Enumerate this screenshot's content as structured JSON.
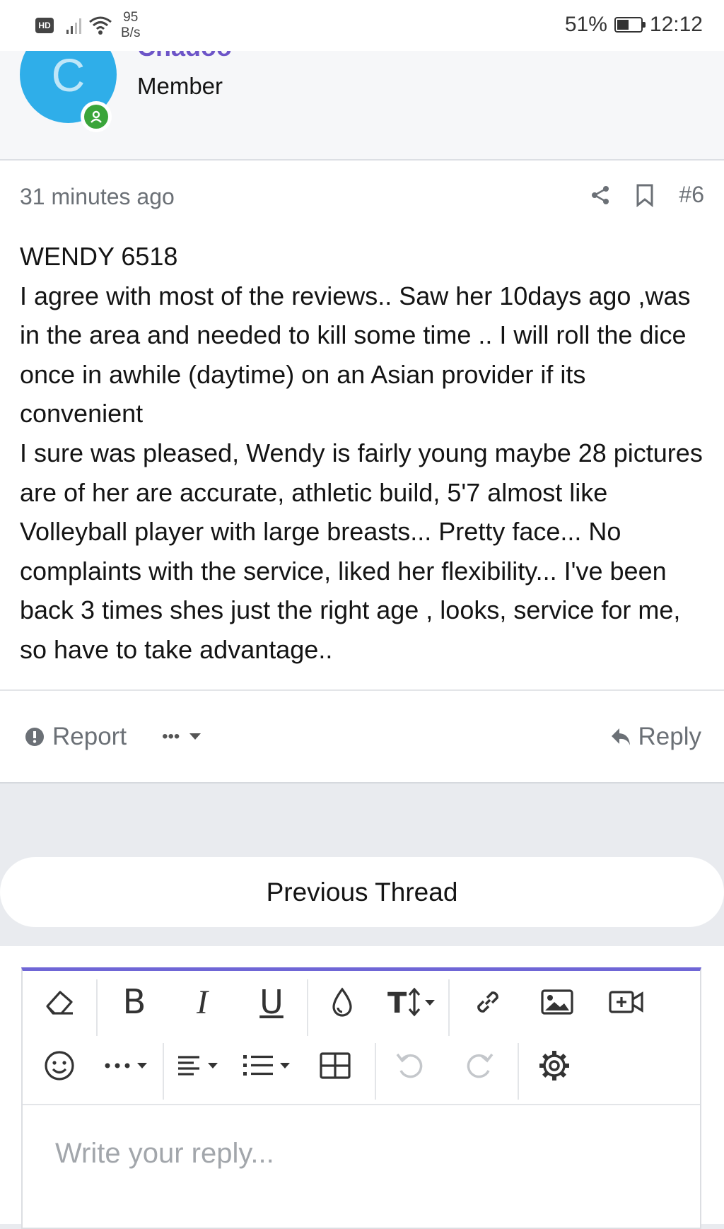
{
  "status_bar": {
    "hd": "HD",
    "net_speed_value": "95",
    "net_speed_unit": "B/s",
    "battery": "51%",
    "battery_level": 0.51,
    "time": "12:12"
  },
  "user": {
    "avatar_letter": "C",
    "name": "Chadoo",
    "role": "Member"
  },
  "post": {
    "time_ago": "31 minutes ago",
    "number": "#6",
    "lines": [
      "WENDY 6518",
      "I agree with most of the reviews.. Saw her 10days ago ,was in the area and needed to kill some time .. I will roll the dice once in awhile (daytime) on an Asian provider if its convenient",
      "I sure was pleased, Wendy is fairly young maybe 28 pictures are of her are accurate, athletic build, 5'7 almost like Volleyball player with large breasts... Pretty face... No complaints with the service, liked her flexibility... I've been back 3 times shes just the right age , looks, service for me, so have to take advantage.."
    ],
    "report_label": "Report",
    "more_label": "•••",
    "reply_label": "Reply"
  },
  "navigation": {
    "previous_thread": "Previous Thread"
  },
  "editor": {
    "placeholder": "Write your reply...",
    "accent_color": "#6f66d6",
    "icons_row1": [
      "eraser-icon",
      "bold-icon",
      "italic-icon",
      "underline-icon",
      "text-color-icon",
      "font-size-icon",
      "link-icon",
      "image-icon",
      "video-icon"
    ],
    "icons_row2": [
      "emoji-icon",
      "more-icon",
      "align-icon",
      "list-icon",
      "table-icon",
      "undo-icon",
      "redo-icon",
      "settings-icon"
    ]
  }
}
